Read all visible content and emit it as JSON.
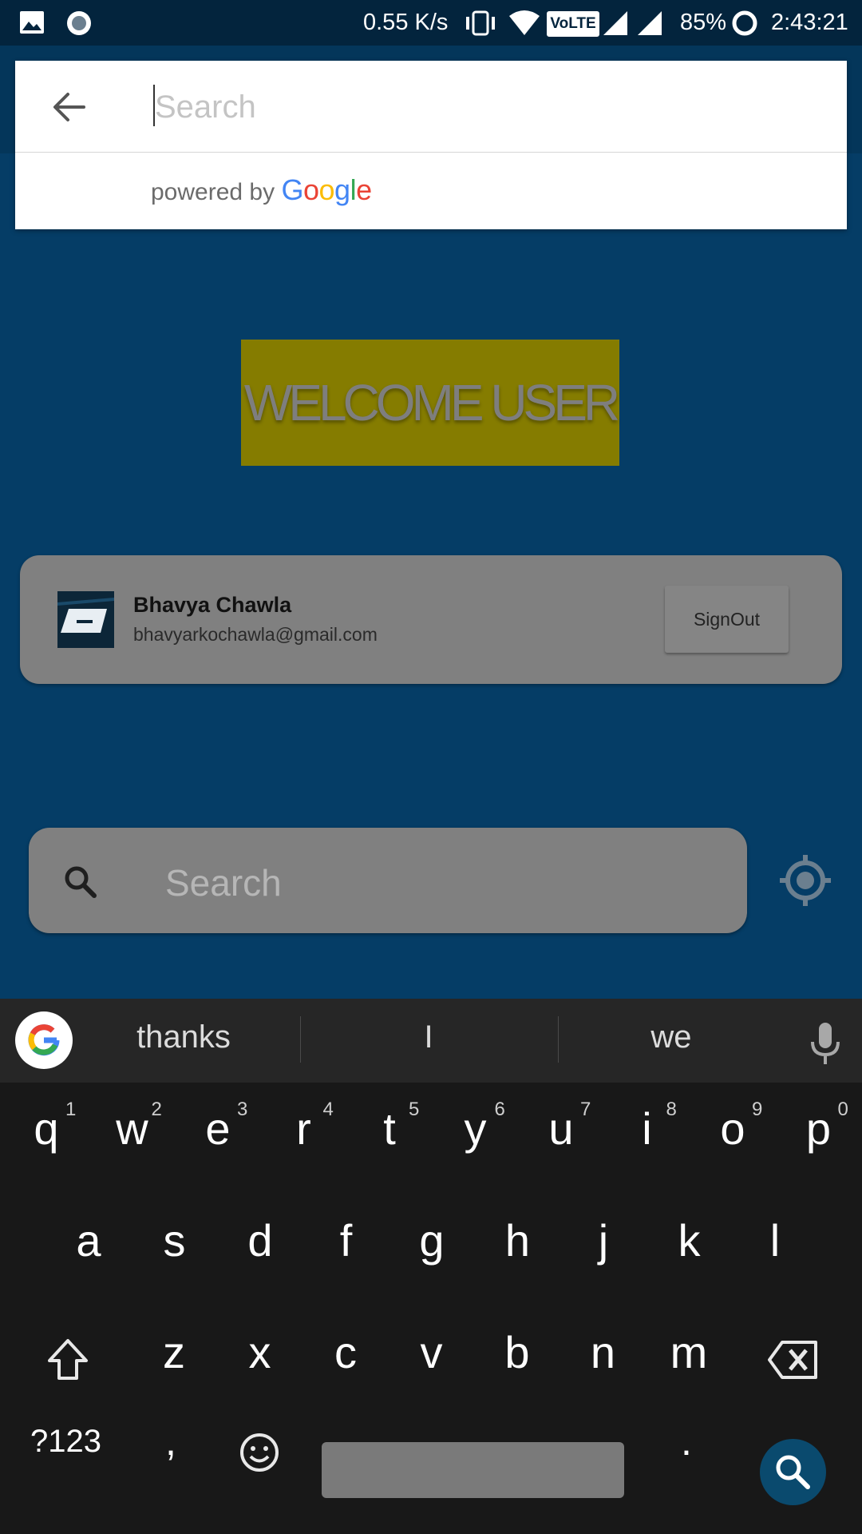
{
  "status_bar": {
    "net_speed": "0.55 K/s",
    "network_badge": "VoLTE",
    "battery": "85%",
    "time": "2:43:21",
    "icons": [
      "image-icon",
      "record-icon",
      "vibrate-icon",
      "wifi-icon",
      "volte-icon",
      "signal-icon",
      "signal-icon",
      "battery-ring-icon"
    ]
  },
  "search_overlay": {
    "back_icon": "back-arrow-icon",
    "placeholder": "Search",
    "powered_by": "powered by",
    "google_letters": [
      "G",
      "o",
      "o",
      "g",
      "l",
      "e"
    ],
    "google_colors": [
      "#4285F4",
      "#EA4335",
      "#FBBC05",
      "#4285F4",
      "#34A853",
      "#EA4335"
    ]
  },
  "welcome": {
    "text": "WELCOME USER",
    "color": "#857c00"
  },
  "account": {
    "name": "Bhavya Chawla",
    "email": "bhavyarkochawla@gmail.com",
    "signout_label": "SignOut"
  },
  "location_search": {
    "placeholder": "Search",
    "search_icon": "search-icon",
    "locate_icon": "my-location-icon"
  },
  "keyboard": {
    "suggestions": [
      "thanks",
      "I",
      "we"
    ],
    "row1": [
      "q",
      "w",
      "e",
      "r",
      "t",
      "y",
      "u",
      "i",
      "o",
      "p"
    ],
    "row1_hints": [
      "1",
      "2",
      "3",
      "4",
      "5",
      "6",
      "7",
      "8",
      "9",
      "0"
    ],
    "row2": [
      "a",
      "s",
      "d",
      "f",
      "g",
      "h",
      "j",
      "k",
      "l"
    ],
    "row3": [
      "z",
      "x",
      "c",
      "v",
      "b",
      "n",
      "m"
    ],
    "symbols_label": "?123",
    "comma": ",",
    "period": ".",
    "accent": "#0a4a6e"
  }
}
